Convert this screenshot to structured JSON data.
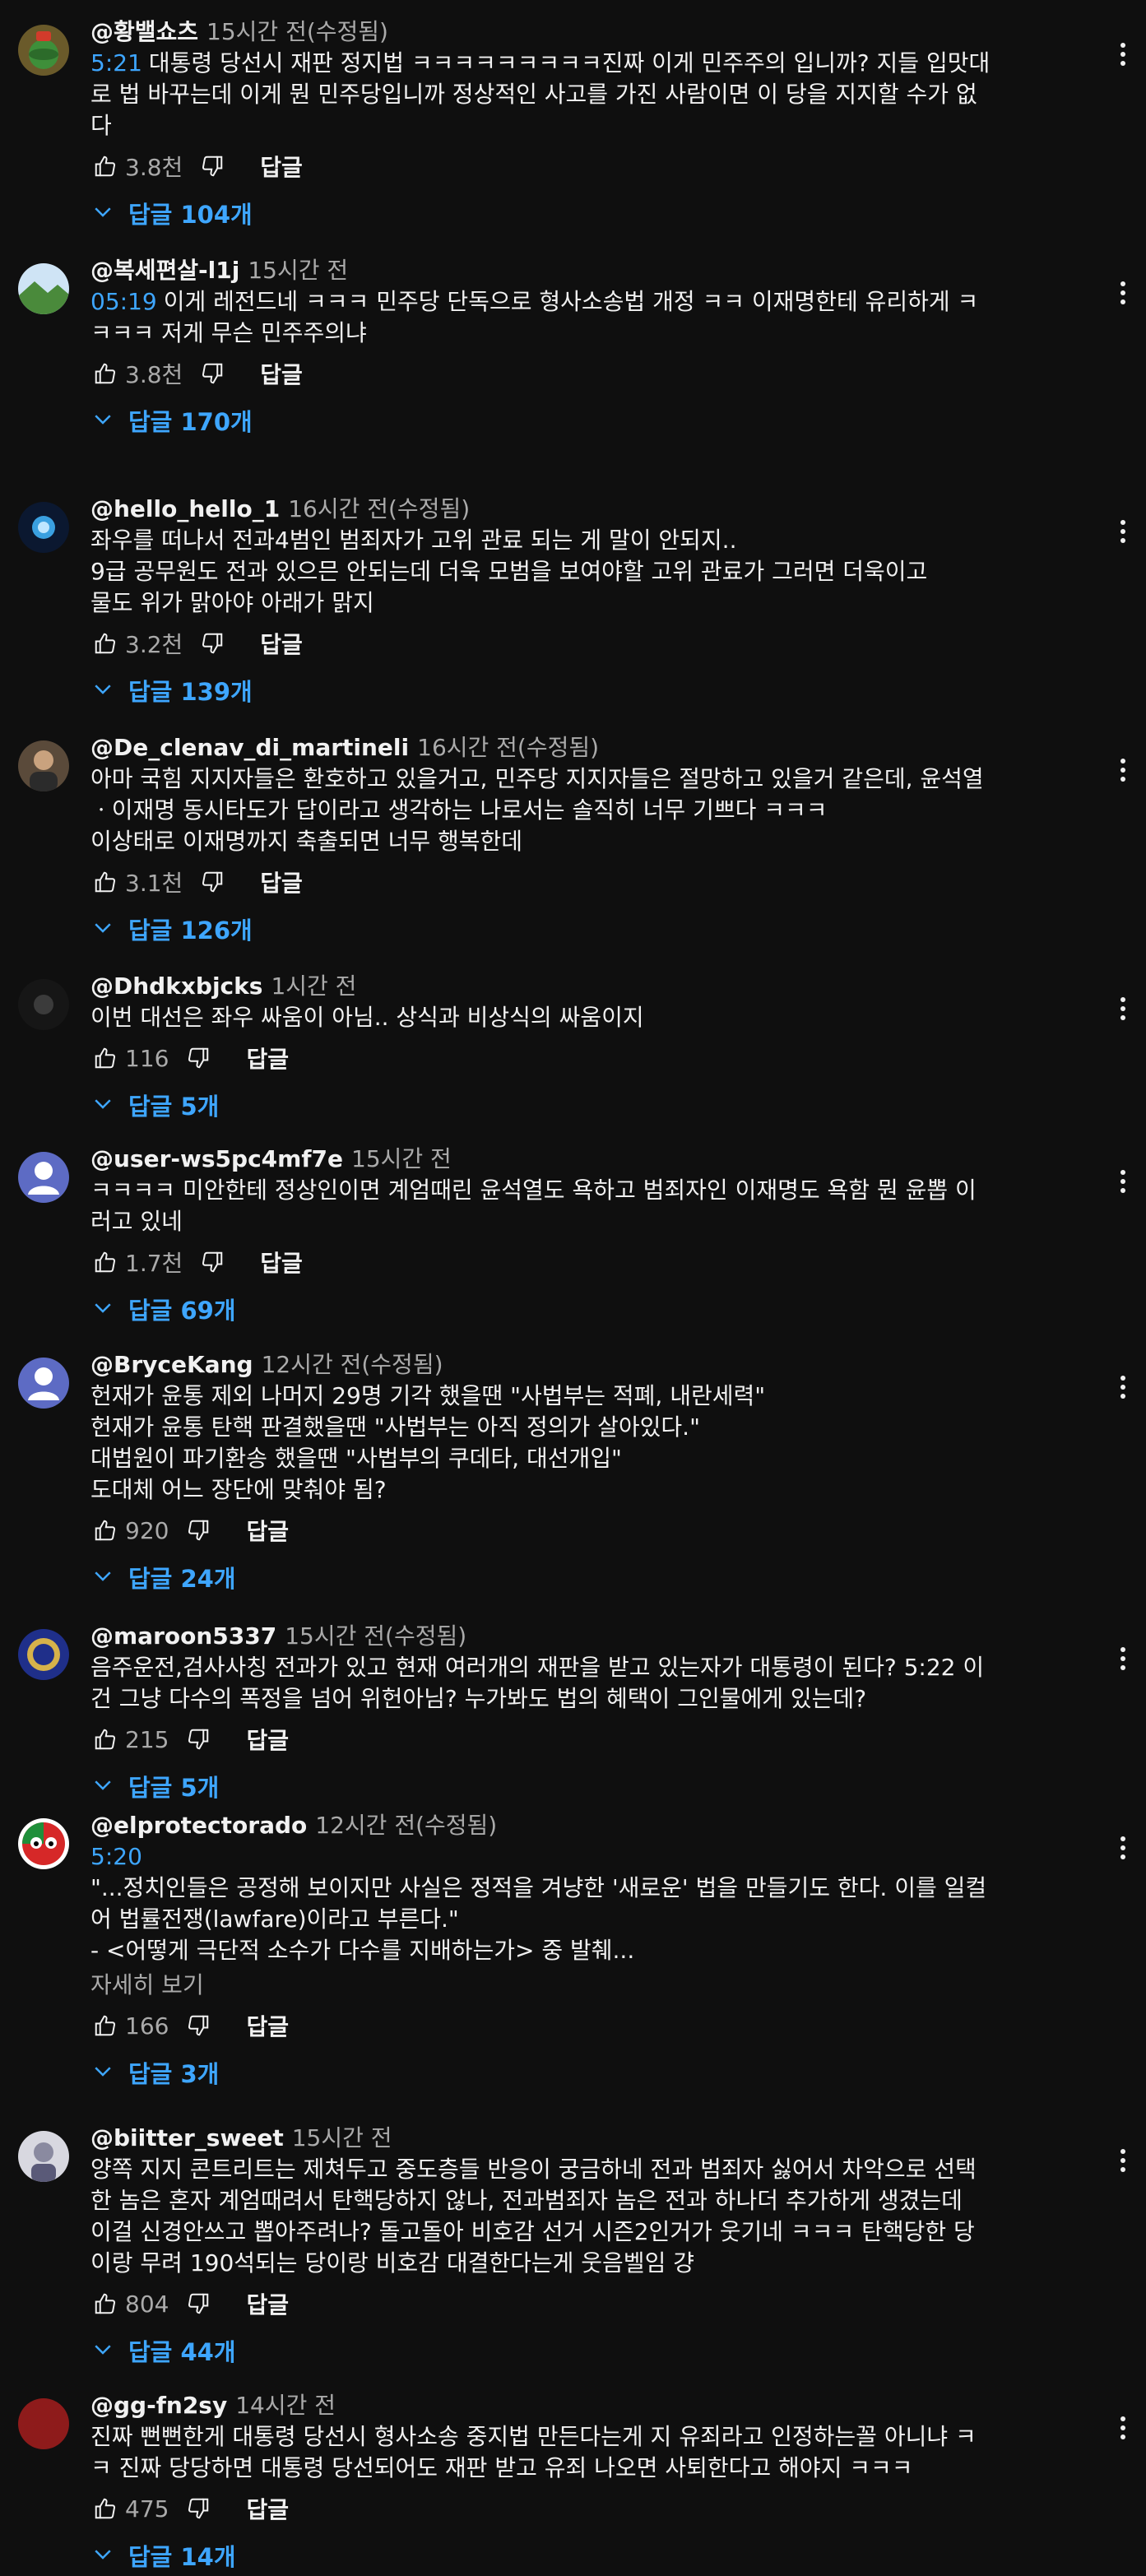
{
  "comments": [
    {
      "author": "@황밸쇼츠",
      "time": "15시간 전(수정됨)",
      "lines": [
        {
          "ts": "5:21",
          "text": "대통령 당선시 재판 정지법 ㅋㅋㅋㅋㅋㅋㅋㅋㅋ진짜 이게 민주주의 입니까? 지들 입맛대"
        },
        {
          "ts": "",
          "text": "로 법 바꾸는데 이게 뭔 민주당입니까 정상적인 사고를 가진 사람이면 이 당을 지지할 수가 없"
        },
        {
          "ts": "",
          "text": "다"
        }
      ],
      "likes": "3.8천",
      "reply_label": "답글",
      "replies": "답글 104개",
      "avatar": "avatar-image-green-globe"
    },
    {
      "author": "@복세편살-l1j",
      "time": "15시간 전",
      "lines": [
        {
          "ts": "05:19",
          "text": "이게 레전드네 ㅋㅋㅋ 민주당 단독으로 형사소송법 개정 ㅋㅋ 이재명한테 유리하게 ㅋ"
        },
        {
          "ts": "",
          "text": "ㅋㅋㅋ 저게 무슨 민주주의냐"
        }
      ],
      "likes": "3.8천",
      "reply_label": "답글",
      "replies": "답글 170개",
      "avatar": "avatar-image-landscape"
    },
    {
      "author": "@hello_hello_1",
      "time": "16시간 전(수정됨)",
      "lines": [
        {
          "ts": "",
          "text": "좌우를 떠나서 전과4범인 범죄자가 고위 관료 되는 게 말이 안되지.."
        },
        {
          "ts": "",
          "text": "9급 공무원도 전과 있으믄 안되는데 더욱 모범을 보여야할 고위 관료가 그러면 더욱이고"
        },
        {
          "ts": "",
          "text": "물도 위가 맑아야 아래가 맑지"
        }
      ],
      "likes": "3.2천",
      "reply_label": "답글",
      "replies": "답글 139개",
      "avatar": "avatar-image-blue-glow"
    },
    {
      "author": "@De_clenav_di_martineli",
      "time": "16시간 전(수정됨)",
      "lines": [
        {
          "ts": "",
          "text": "아마 국힘 지지자들은 환호하고 있을거고, 민주당 지지자들은 절망하고 있을거 같은데, 윤석열"
        },
        {
          "ts": "",
          "text": "ㆍ이재명 동시타도가 답이라고 생각하는 나로서는 솔직히 너무 기쁘다 ㅋㅋㅋ"
        },
        {
          "ts": "",
          "text": "이상태로 이재명까지 축출되면 너무 행복한데"
        }
      ],
      "likes": "3.1천",
      "reply_label": "답글",
      "replies": "답글 126개",
      "avatar": "avatar-image-portrait"
    },
    {
      "author": "@Dhdkxbjcks",
      "time": "1시간 전",
      "lines": [
        {
          "ts": "",
          "text": "이번 대선은 좌우 싸움이 아님.. 상식과 비상식의 싸움이지"
        }
      ],
      "likes": "116",
      "reply_label": "답글",
      "replies": "답글 5개",
      "avatar": "avatar-image-dark"
    },
    {
      "author": "@user-ws5pc4mf7e",
      "time": "15시간 전",
      "lines": [
        {
          "ts": "",
          "text": "ㅋㅋㅋㅋ 미안한테 정상인이면 계엄때린 윤석열도 욕하고 범죄자인 이재명도 욕함 뭔 윤뽑 이"
        },
        {
          "ts": "",
          "text": "러고 있네"
        }
      ],
      "likes": "1.7천",
      "reply_label": "답글",
      "replies": "답글 69개",
      "avatar": "avatar-default-person"
    },
    {
      "author": "@BryceKang",
      "time": "12시간 전(수정됨)",
      "lines": [
        {
          "ts": "",
          "text": "헌재가 윤통 제외 나머지 29명 기각 했을땐 \"사법부는 적폐, 내란세력\""
        },
        {
          "ts": "",
          "text": "헌재가 윤통 탄핵 판결했을땐 \"사법부는 아직 정의가 살아있다.\""
        },
        {
          "ts": "",
          "text": "대법원이 파기환송 했을땐 \"사법부의 쿠데타, 대선개입\""
        },
        {
          "ts": "",
          "text": "도대체 어느 장단에 맞춰야 됨?"
        }
      ],
      "likes": "920",
      "reply_label": "답글",
      "replies": "답글 24개",
      "avatar": "avatar-default-person"
    },
    {
      "author": "@maroon5337",
      "time": "15시간 전(수정됨)",
      "lines": [
        {
          "ts": "",
          "text": "음주운전,검사사칭 전과가 있고 현재 여러개의 재판을 받고 있는자가 대통령이 된다? 5:22 이"
        },
        {
          "ts": "",
          "text": "건 그냥 다수의 폭정을 넘어 위헌아님? 누가봐도 법의 혜택이 그인물에게 있는데?"
        }
      ],
      "likes": "215",
      "reply_label": "답글",
      "replies": "답글 5개",
      "avatar": "avatar-image-emblem"
    },
    {
      "author": "@elprotectorado",
      "time": "12시간 전(수정됨)",
      "lines": [
        {
          "ts": "5:20",
          "text": ""
        },
        {
          "ts": "",
          "text": "\"...정치인들은 공정해 보이지만 사실은 정적을 겨냥한 '새로운' 법을 만들기도 한다. 이를 일컬"
        },
        {
          "ts": "",
          "text": "어 법률전쟁(lawfare)이라고 부른다.\""
        },
        {
          "ts": "",
          "text": "- <어떻게 극단적 소수가 다수를 지배하는가> 중 발췌..."
        }
      ],
      "show_more": "자세히 보기",
      "likes": "166",
      "reply_label": "답글",
      "replies": "답글 3개",
      "avatar": "avatar-image-countryball"
    },
    {
      "author": "@biitter_sweet",
      "time": "15시간 전",
      "lines": [
        {
          "ts": "",
          "text": "양쪽 지지 콘트리트는 제쳐두고 중도층들 반응이 궁금하네 전과 범죄자 싫어서 차악으로 선택"
        },
        {
          "ts": "",
          "text": "한 놈은 혼자 계엄때려서 탄핵당하지 않나, 전과범죄자 놈은 전과 하나더 추가하게 생겼는데"
        },
        {
          "ts": "",
          "text": "이걸 신경안쓰고 뽑아주려나? 돌고돌아 비호감 선거 시즌2인거가 웃기네 ㅋㅋㅋ 탄핵당한 당"
        },
        {
          "ts": "",
          "text": "이랑 무려 190석되는 당이랑 비호감 대결한다는게 웃음벨임 걍"
        }
      ],
      "likes": "804",
      "reply_label": "답글",
      "replies": "답글 44개",
      "avatar": "avatar-image-sketch"
    },
    {
      "author": "@gg-fn2sy",
      "time": "14시간 전",
      "lines": [
        {
          "ts": "",
          "text": "진짜 뻔뻔한게 대통령 당선시 형사소송 중지법 만든다는게 지 유죄라고 인정하는꼴 아니냐 ㅋ"
        },
        {
          "ts": "",
          "text": "ㅋ 진짜 당당하면 대통령 당선되어도 재판 받고 유죄 나오면 사퇴한다고 해야지 ㅋㅋㅋ"
        }
      ],
      "likes": "475",
      "reply_label": "답글",
      "replies": "답글 14개",
      "avatar": "avatar-image-red"
    }
  ],
  "colors": {
    "background": "#0f0f0f",
    "text": "#f1f1f1",
    "muted": "#aaaaaa",
    "link": "#3ea6ff"
  }
}
